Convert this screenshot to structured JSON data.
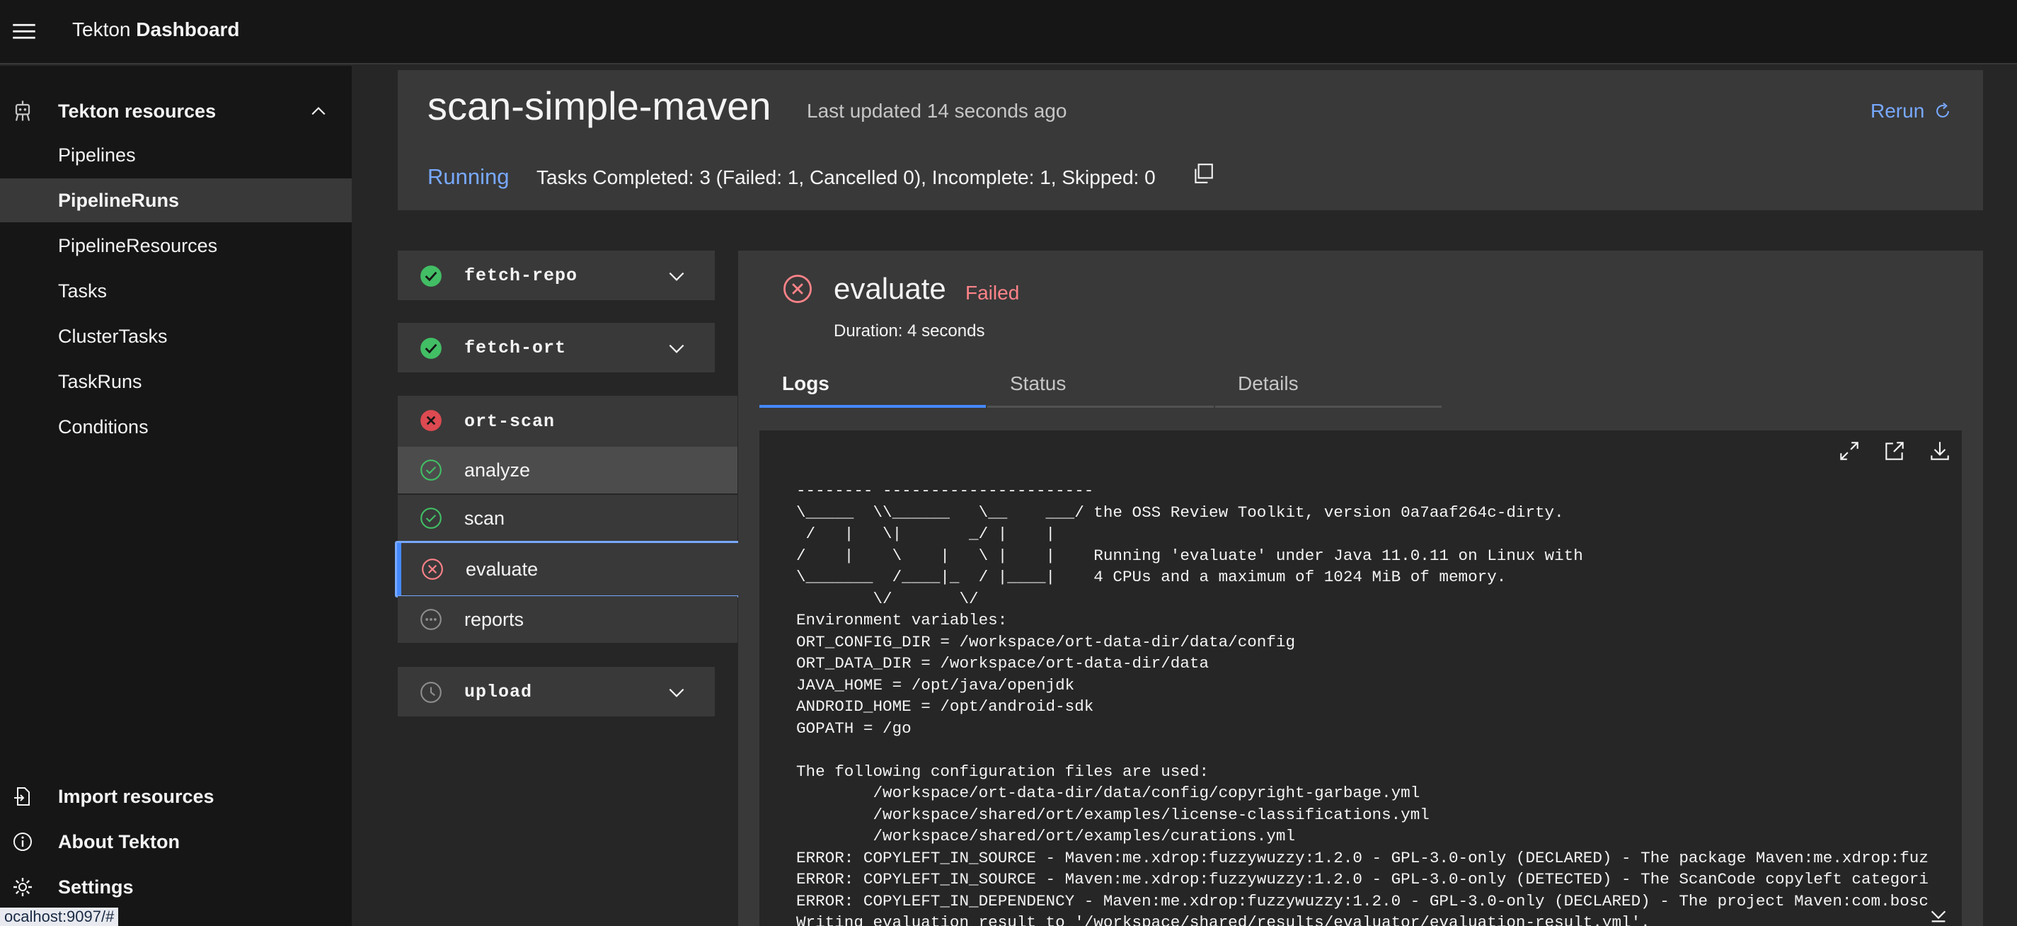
{
  "header": {
    "app_title_prefix": "Tekton",
    "app_title_bold": "Dashboard"
  },
  "sidenav": {
    "group_label": "Tekton resources",
    "items": [
      {
        "label": "Pipelines",
        "active": false
      },
      {
        "label": "PipelineRuns",
        "active": true
      },
      {
        "label": "PipelineResources",
        "active": false
      },
      {
        "label": "Tasks",
        "active": false
      },
      {
        "label": "ClusterTasks",
        "active": false
      },
      {
        "label": "TaskRuns",
        "active": false
      },
      {
        "label": "Conditions",
        "active": false
      }
    ],
    "bottom": [
      {
        "label": "Import resources",
        "icon": "import-icon"
      },
      {
        "label": "About Tekton",
        "icon": "info-icon"
      },
      {
        "label": "Settings",
        "icon": "gear-icon"
      }
    ]
  },
  "status_url": "ocalhost:9097/#",
  "run": {
    "name": "scan-simple-maven",
    "last_updated": "Last updated 14 seconds ago",
    "rerun_label": "Rerun",
    "status": "Running",
    "summary": "Tasks Completed: 3 (Failed: 1, Cancelled 0), Incomplete: 1, Skipped: 0"
  },
  "tasks": {
    "fetch_repo": "fetch-repo",
    "fetch_ort": "fetch-ort",
    "ort_scan": "ort-scan",
    "steps": [
      "analyze",
      "scan",
      "evaluate",
      "reports"
    ],
    "upload": "upload"
  },
  "detail": {
    "title": "evaluate",
    "status": "Failed",
    "duration": "Duration: 4 seconds",
    "tabs": [
      "Logs",
      "Status",
      "Details"
    ]
  },
  "logs": "-------- ----------------------\n\\_____  \\\\______   \\__    ___/ the OSS Review Toolkit, version 0a7aaf264c-dirty.\n /   |   \\|       _/ |    |\n/    |    \\    |   \\ |    |    Running 'evaluate' under Java 11.0.11 on Linux with\n\\_______  /____|_  / |____|    4 CPUs and a maximum of 1024 MiB of memory.\n        \\/       \\/\nEnvironment variables:\nORT_CONFIG_DIR = /workspace/ort-data-dir/data/config\nORT_DATA_DIR = /workspace/ort-data-dir/data\nJAVA_HOME = /opt/java/openjdk\nANDROID_HOME = /opt/android-sdk\nGOPATH = /go\n\nThe following configuration files are used:\n        /workspace/ort-data-dir/data/config/copyright-garbage.yml\n        /workspace/shared/ort/examples/license-classifications.yml\n        /workspace/shared/ort/examples/curations.yml\nERROR: COPYLEFT_IN_SOURCE - Maven:me.xdrop:fuzzywuzzy:1.2.0 - GPL-3.0-only (DECLARED) - The package Maven:me.xdrop:fuz\nERROR: COPYLEFT_IN_SOURCE - Maven:me.xdrop:fuzzywuzzy:1.2.0 - GPL-3.0-only (DETECTED) - The ScanCode copyleft categori\nERROR: COPYLEFT_IN_DEPENDENCY - Maven:me.xdrop:fuzzywuzzy:1.2.0 - GPL-3.0-only (DECLARED) - The project Maven:com.bosc\nWriting evaluation result to '/workspace/shared/results/evaluator/evaluation-result.yml'."
}
